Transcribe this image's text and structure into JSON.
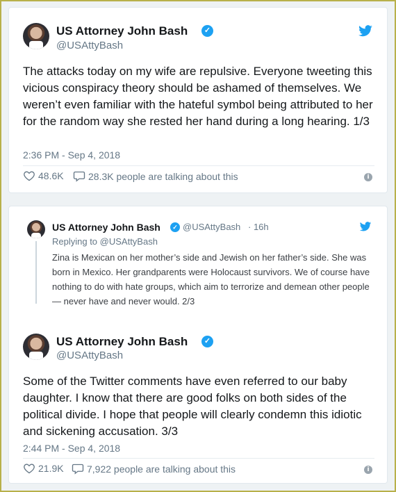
{
  "colors": {
    "accent": "#1da1f2",
    "muted": "#657786",
    "text": "#14171a"
  },
  "tweet1": {
    "name": "US Attorney John Bash",
    "handle": "@USAttyBash",
    "text": "The attacks today on my wife are repulsive. Everyone tweeting this vicious conspiracy theory should be ashamed of themselves. We weren’t even familiar with the hateful symbol being attributed to her for the random way she rested her hand during a long hearing. 1/3",
    "timestamp": "2:36 PM - Sep 4, 2018",
    "likes": "48.6K",
    "talking": "28.3K people are talking about this"
  },
  "tweet2": {
    "name": "US Attorney John Bash",
    "handle": "@USAttyBash",
    "time_ago": "· 16h",
    "replying_to": "Replying to @USAttyBash",
    "text": "Zina is Mexican on her mother’s side and Jewish on her father’s side. She was born in Mexico. Her grandparents were Holocaust survivors. We of course have nothing to do with hate groups, which aim to terrorize and demean other people — never have and never would. 2/3"
  },
  "tweet3": {
    "name": "US Attorney John Bash",
    "handle": "@USAttyBash",
    "text": "Some of the Twitter comments have even referred to our baby daughter. I know that there are good folks on both sides of the political divide. I hope that people will clearly condemn this idiotic and sickening accusation. 3/3",
    "timestamp": "2:44 PM - Sep 4, 2018",
    "likes": "21.9K",
    "talking": "7,922 people are talking about this"
  },
  "icons": [
    "avatar",
    "verified-icon",
    "twitter-bird-icon",
    "heart-icon",
    "comment-icon",
    "info-icon"
  ]
}
